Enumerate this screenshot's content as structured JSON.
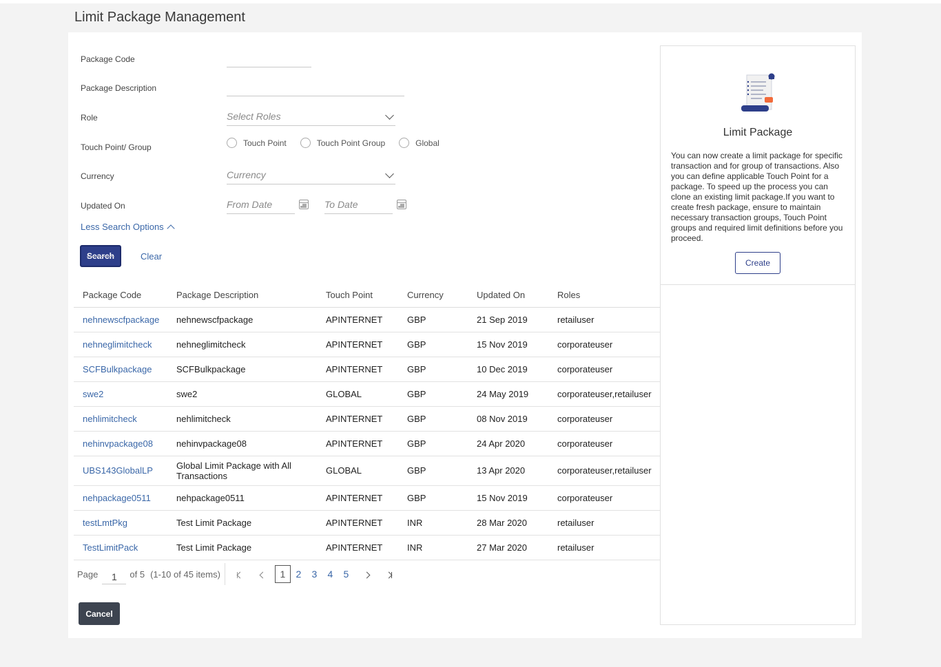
{
  "page": {
    "title": "Limit Package Management"
  },
  "search": {
    "labels": {
      "package_code": "Package Code",
      "package_description": "Package Description",
      "role": "Role",
      "touch_point_group": "Touch Point/ Group",
      "currency": "Currency",
      "updated_on": "Updated On"
    },
    "role_placeholder": "Select Roles",
    "currency_placeholder": "Currency",
    "from_date_placeholder": "From Date",
    "to_date_placeholder": "To Date",
    "radio_options": [
      "Touch Point",
      "Touch Point Group",
      "Global"
    ],
    "less_options_label": "Less Search Options",
    "search_button": "Search",
    "clear_button": "Clear"
  },
  "table": {
    "columns": [
      "Package Code",
      "Package Description",
      "Touch Point",
      "Currency",
      "Updated On",
      "Roles"
    ],
    "rows": [
      [
        "nehnewscfpackage",
        "nehnewscfpackage",
        "APINTERNET",
        "GBP",
        "21 Sep 2019",
        "retailuser"
      ],
      [
        "nehneglimitcheck",
        "nehneglimitcheck",
        "APINTERNET",
        "GBP",
        "15 Nov 2019",
        "corporateuser"
      ],
      [
        "SCFBulkpackage",
        "SCFBulkpackage",
        "APINTERNET",
        "GBP",
        "10 Dec 2019",
        "corporateuser"
      ],
      [
        "swe2",
        "swe2",
        "GLOBAL",
        "GBP",
        "24 May 2019",
        "corporateuser,retailuser"
      ],
      [
        "nehlimitcheck",
        "nehlimitcheck",
        "APINTERNET",
        "GBP",
        "08 Nov 2019",
        "corporateuser"
      ],
      [
        "nehinvpackage08",
        "nehinvpackage08",
        "APINTERNET",
        "GBP",
        "24 Apr 2020",
        "corporateuser"
      ],
      [
        "UBS143GlobalLP",
        "Global Limit Package with All Transactions",
        "GLOBAL",
        "GBP",
        "13 Apr 2020",
        "corporateuser,retailuser"
      ],
      [
        "nehpackage0511",
        "nehpackage0511",
        "APINTERNET",
        "GBP",
        "15 Nov 2019",
        "corporateuser"
      ],
      [
        "testLmtPkg",
        "Test Limit Package",
        "APINTERNET",
        "INR",
        "28 Mar 2020",
        "retailuser"
      ],
      [
        "TestLimitPack",
        "Test Limit Package",
        "APINTERNET",
        "INR",
        "27 Mar 2020",
        "retailuser"
      ]
    ]
  },
  "pager": {
    "page_label": "Page",
    "current_page": "1",
    "of_label": "of 5",
    "items_label": "(1-10 of 45 items)",
    "pages": [
      "1",
      "2",
      "3",
      "4",
      "5"
    ]
  },
  "cancel_button": "Cancel",
  "side_panel": {
    "title": "Limit Package",
    "description": "You can now create a limit package for specific transaction and for group of transactions. Also you can define applicable Touch Point for a package. To speed up the process you can clone an existing limit package.If you want to create fresh package, ensure to maintain necessary transaction groups, Touch Point groups and required limit definitions before you proceed.",
    "create_button": "Create"
  },
  "colors": {
    "primary": "#2e3f8a",
    "link": "#3a67a8",
    "accent": "#f26b3a"
  }
}
